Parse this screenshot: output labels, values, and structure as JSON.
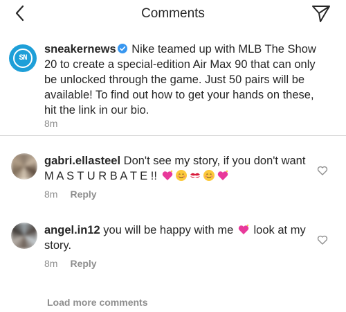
{
  "header": {
    "title": "Comments",
    "back_icon": "chevron-left-icon",
    "share_icon": "paper-plane-icon"
  },
  "post": {
    "username": "sneakernews",
    "verified_icon": "verified-badge-icon",
    "caption": "Nike teamed up with MLB The Show 20 to create a special-edition Air Max 90 that can only be unlocked through the game. Just 50 pairs will be available! To find out how to get your hands on these, hit the link in our bio.",
    "time": "8m",
    "brand_color": "#1e9fd8"
  },
  "comments": [
    {
      "username": "gabri.ellasteel",
      "text_part1": "Don't see my story, if you don't want M A S T U R B A T E !!",
      "emojis": [
        "sparkling-heart-emoji",
        "blushing-face-emoji",
        "kiss-mark-emoji",
        "blushing-face-emoji",
        "sparkling-heart-emoji"
      ],
      "time": "8m",
      "reply_label": "Reply"
    },
    {
      "username": "angel.in12",
      "text_part1": "you will be happy with me",
      "emojis": [
        "sparkling-heart-emoji"
      ],
      "text_part2": "look at my story.",
      "time": "8m",
      "reply_label": "Reply"
    }
  ],
  "load_more_label": "Load more comments",
  "colors": {
    "text": "#262626",
    "muted": "#8e8e8e",
    "divider": "#dbdbdb"
  }
}
